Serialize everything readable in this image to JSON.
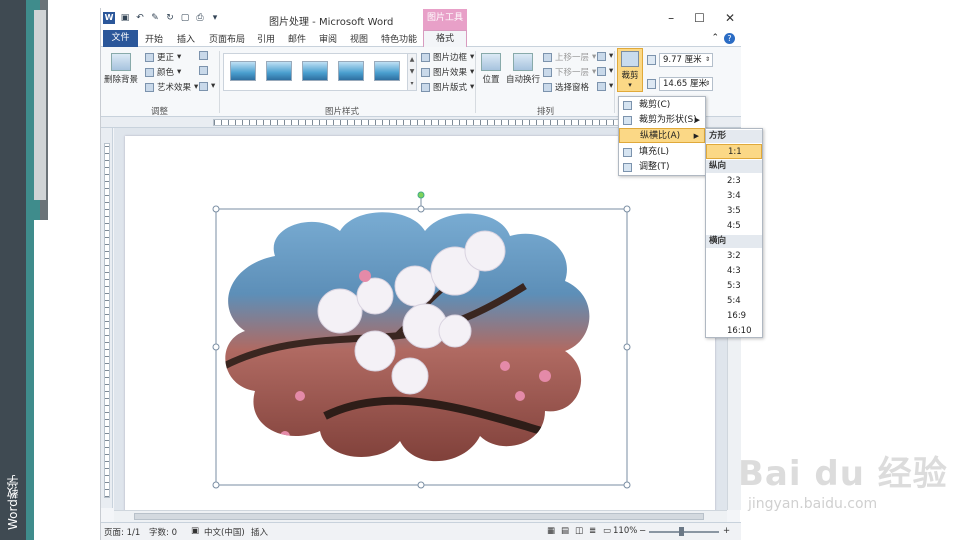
{
  "slide": {
    "side_label": "Word教学"
  },
  "window": {
    "title": "图片处理 - Microsoft Word",
    "context_tab_title": "图片工具",
    "qat_logo": "W",
    "win_buttons": [
      "–",
      "☐",
      "✕"
    ]
  },
  "tabs": {
    "file": "文件",
    "items": [
      "开始",
      "插入",
      "页面布局",
      "引用",
      "邮件",
      "审阅",
      "视图",
      "特色功能"
    ],
    "format": "格式",
    "help": "?"
  },
  "ribbon": {
    "adjust": {
      "label": "调整",
      "remove_bg": "删除背景",
      "corrections": "更正",
      "color": "颜色",
      "artistic": "艺术效果"
    },
    "styles": {
      "label": "图片样式",
      "border": "图片边框",
      "effects": "图片效果",
      "layout": "图片版式"
    },
    "arrange": {
      "label": "排列",
      "position": "位置",
      "wrap": "自动换行",
      "bring_forward": "上移一层",
      "send_backward": "下移一层",
      "selection_pane": "选择窗格"
    },
    "size": {
      "crop": "裁剪",
      "height": "9.77 厘米",
      "width": "14.65 厘米"
    }
  },
  "crop_menu": {
    "items": [
      {
        "label": "裁剪(C)"
      },
      {
        "label": "裁剪为形状(S)"
      },
      {
        "label": "纵横比(A)"
      },
      {
        "label": "填充(L)"
      },
      {
        "label": "调整(T)"
      }
    ]
  },
  "aspect_menu": {
    "square_header": "方形",
    "square": [
      "1:1"
    ],
    "portrait_header": "纵向",
    "portrait": [
      "2:3",
      "3:4",
      "3:5",
      "4:5"
    ],
    "landscape_header": "横向",
    "landscape": [
      "3:2",
      "4:3",
      "5:3",
      "5:4",
      "16:9",
      "16:10"
    ]
  },
  "status": {
    "page": "页面: 1/1",
    "words": "字数: 0",
    "lang": "中文(中国)",
    "mode": "插入",
    "zoom": "110%",
    "minus": "−",
    "plus": "+"
  },
  "watermark": {
    "logo": "Bai du 经验",
    "url": "jingyan.baidu.com"
  },
  "colors": {
    "accent": "#2b579a",
    "context_pink": "#e8a0c8",
    "highlight": "#fbd886"
  }
}
